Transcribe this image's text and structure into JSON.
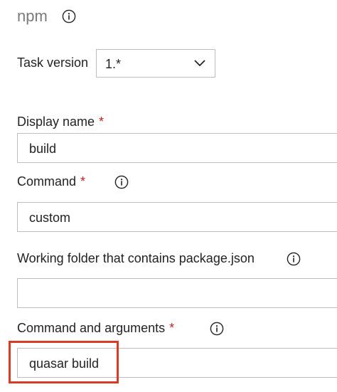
{
  "task": {
    "title": "npm",
    "info_icon": "info-circle-icon"
  },
  "task_version": {
    "label": "Task version",
    "value": "1.*",
    "dropdown_icon": "chevron-down-icon"
  },
  "fields": {
    "display_name": {
      "label": "Display name",
      "required_mark": "*",
      "value": "build"
    },
    "command": {
      "label": "Command",
      "required_mark": "*",
      "value": "custom",
      "info_icon": "info-circle-icon"
    },
    "working_folder": {
      "label": "Working folder that contains package.json",
      "value": "",
      "info_icon": "info-circle-icon"
    },
    "command_args": {
      "label": "Command and arguments",
      "required_mark": "*",
      "value": "quasar build",
      "info_icon": "info-circle-icon"
    }
  },
  "colors": {
    "required": "#b5281d",
    "highlight": "#d93c24",
    "border": "#bdbdbd",
    "title": "#7a7a7a"
  }
}
